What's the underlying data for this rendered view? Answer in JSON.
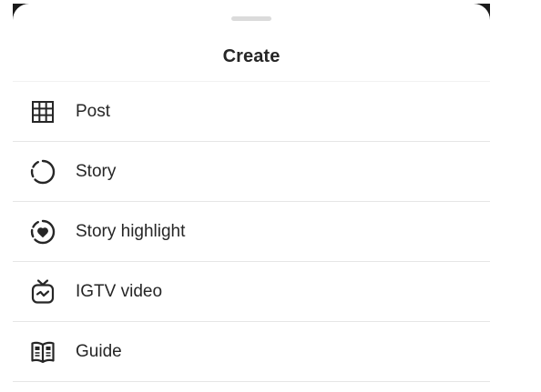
{
  "sheet": {
    "title": "Create"
  },
  "menu": {
    "items": [
      {
        "label": "Post",
        "icon": "grid-icon"
      },
      {
        "label": "Story",
        "icon": "story-dashed-circle-icon"
      },
      {
        "label": "Story highlight",
        "icon": "story-highlight-heart-icon"
      },
      {
        "label": "IGTV video",
        "icon": "igtv-tv-icon"
      },
      {
        "label": "Guide",
        "icon": "guide-book-icon"
      }
    ]
  },
  "colors": {
    "text": "#262626",
    "divider": "#e6e6e6",
    "grabber": "#dbdbdb",
    "backdrop": "#1b1b1b"
  }
}
